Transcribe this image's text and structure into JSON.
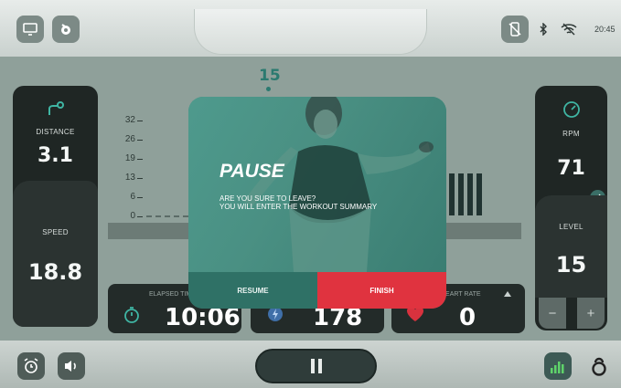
{
  "status": {
    "time": "20:45"
  },
  "marker_value": "15",
  "left": {
    "distance_label": "DISTANCE",
    "distance_value": "3.1",
    "speed_label": "SPEED",
    "speed_value": "18.8"
  },
  "right": {
    "rpm_label": "RPM",
    "rpm_value": "71",
    "level_label": "LEVEL",
    "level_value": "15",
    "minus": "−",
    "plus": "+"
  },
  "chart_data": {
    "type": "bar",
    "y_ticks": [
      "32",
      "26",
      "19",
      "13",
      "6",
      "0"
    ],
    "ylim": [
      0,
      32
    ]
  },
  "cards": {
    "elapsed_label": "ELAPSED TIME",
    "elapsed_value": "10:06",
    "calories_value": "178",
    "heart_label": "HEART RATE",
    "heart_value": "0"
  },
  "modal": {
    "title": "PAUSE",
    "line1": "ARE YOU SURE TO LEAVE?",
    "line2": "YOU WILL ENTER THE WORKOUT SUMMARY",
    "resume_label": "RESUME",
    "finish_label": "FINISH"
  },
  "colors": {
    "accent": "#3d8a7e",
    "finish": "#e0333f",
    "panel": "#1f2624"
  }
}
